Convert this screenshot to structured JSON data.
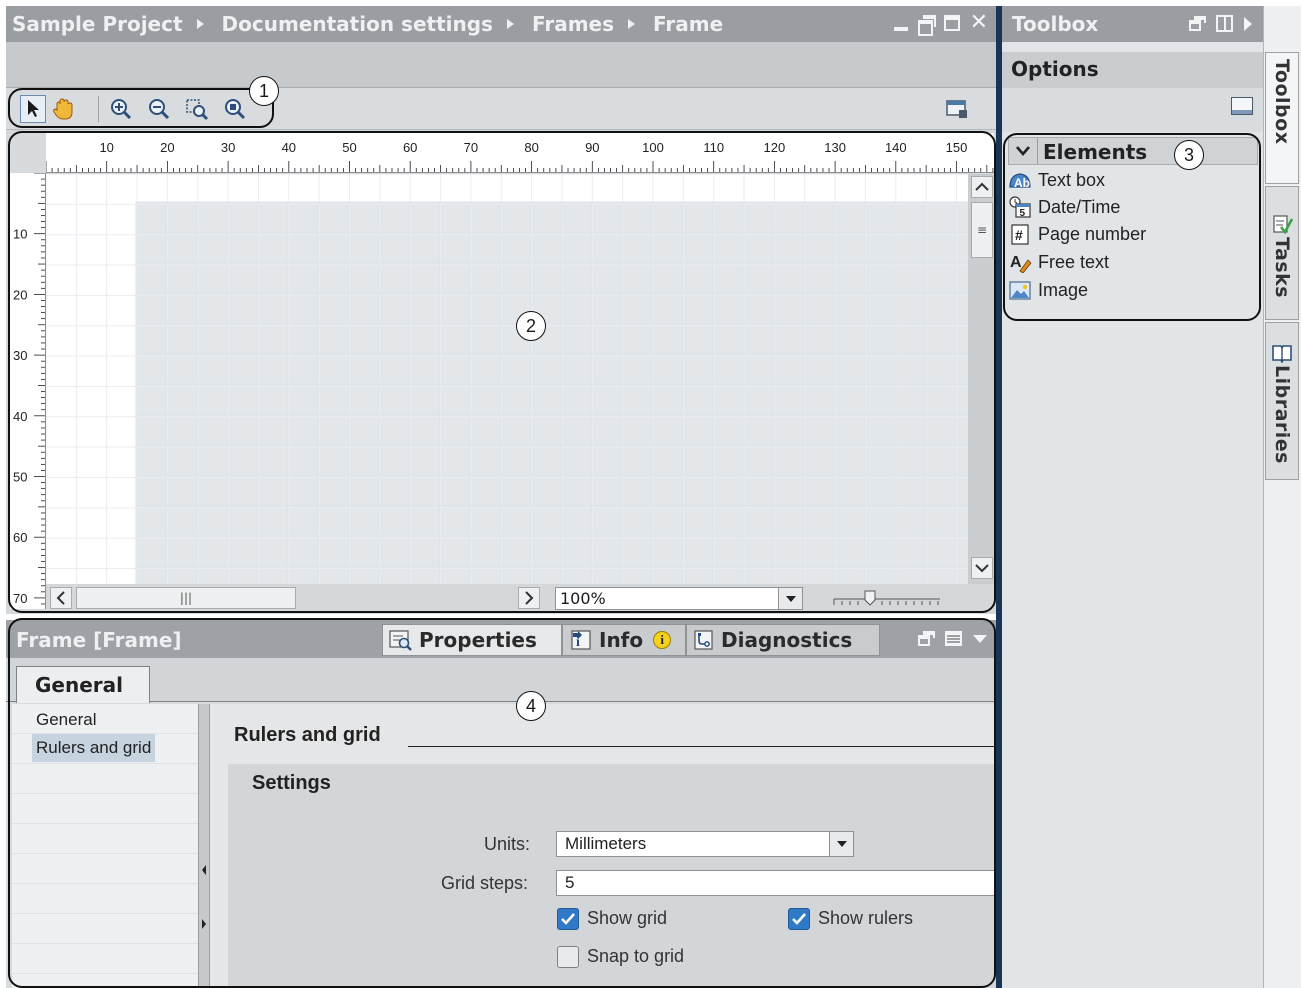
{
  "editor": {
    "breadcrumb": [
      "Sample Project",
      "Documentation settings",
      "Frames",
      "Frame"
    ],
    "zoom": "100%",
    "hruler_ticks": [
      "10",
      "20",
      "30",
      "40",
      "50",
      "60",
      "70",
      "80",
      "90",
      "100",
      "110",
      "120",
      "130",
      "140",
      "150"
    ],
    "vruler_ticks": [
      "10",
      "20",
      "30",
      "40",
      "50",
      "60",
      "70"
    ]
  },
  "callouts": [
    "1",
    "2",
    "3",
    "4"
  ],
  "inspector": {
    "title": "Frame [Frame]",
    "tabs": [
      "Properties",
      "Info",
      "Diagnostics"
    ],
    "general_tab": "General",
    "nav_items": [
      "General",
      "Rulers and grid"
    ],
    "section_title": "Rulers and grid",
    "settings_title": "Settings",
    "units_label": "Units:",
    "units_value": "Millimeters",
    "grid_steps_label": "Grid steps:",
    "grid_steps_value": "5",
    "show_grid": {
      "label": "Show grid",
      "checked": true
    },
    "show_rulers": {
      "label": "Show rulers",
      "checked": true
    },
    "snap_to_grid": {
      "label": "Snap to grid",
      "checked": false
    }
  },
  "toolbox": {
    "title": "Toolbox",
    "options_title": "Options",
    "elements_title": "Elements",
    "elements": [
      {
        "label": "Text box",
        "icon": "text-box-icon"
      },
      {
        "label": "Date/Time",
        "icon": "date-time-icon"
      },
      {
        "label": "Page number",
        "icon": "page-number-icon"
      },
      {
        "label": "Free text",
        "icon": "free-text-icon"
      },
      {
        "label": "Image",
        "icon": "image-icon"
      }
    ],
    "side_tabs": [
      "Toolbox",
      "Tasks",
      "Libraries"
    ]
  },
  "colors": {
    "titlebar": "#9a9ea2",
    "toolbox_separator": "#1b3354",
    "checkbox_on": "#2f79c6",
    "grid_line": "#dde3ec"
  }
}
